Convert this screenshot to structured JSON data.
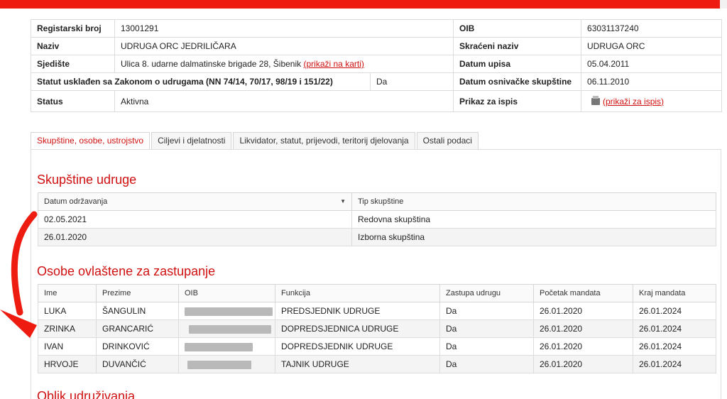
{
  "info": {
    "registarski_broj": {
      "label": "Registarski broj",
      "value": "13001291"
    },
    "oib": {
      "label": "OIB",
      "value": "63031137240"
    },
    "naziv": {
      "label": "Naziv",
      "value": "UDRUGA ORC JEDRILIČARA"
    },
    "skraceni_naziv": {
      "label": "Skraćeni naziv",
      "value": "UDRUGA ORC"
    },
    "sjediste": {
      "label": "Sjedište",
      "value": "Ulica 8. udarne dalmatinske brigade 28, Šibenik",
      "link": "(prikaži na karti)"
    },
    "datum_upisa": {
      "label": "Datum upisa",
      "value": "05.04.2011"
    },
    "statut": {
      "label": "Statut usklađen sa Zakonom o udrugama (NN 74/14, 70/17, 98/19 i 151/22)",
      "value": "Da"
    },
    "datum_osnivacke": {
      "label": "Datum osnivačke skupštine",
      "value": "06.11.2010"
    },
    "status": {
      "label": "Status",
      "value": "Aktivna"
    },
    "prikaz": {
      "label": "Prikaz za ispis",
      "link": "(prikaži za ispis)"
    }
  },
  "tabs": [
    {
      "label": "Skupštine, osobe, ustrojstvo"
    },
    {
      "label": "Ciljevi i djelatnosti"
    },
    {
      "label": "Likvidator, statut, prijevodi, teritorij djelovanja"
    },
    {
      "label": "Ostali podaci"
    }
  ],
  "skupstine": {
    "title": "Skupštine udruge",
    "headers": [
      "Datum održavanja",
      "Tip skupštine"
    ],
    "rows": [
      [
        "02.05.2021",
        "Redovna skupština"
      ],
      [
        "26.01.2020",
        "Izborna skupština"
      ]
    ]
  },
  "osobe": {
    "title": "Osobe ovlaštene za zastupanje",
    "headers": [
      "Ime",
      "Prezime",
      "OIB",
      "Funkcija",
      "Zastupa udrugu",
      "Početak mandata",
      "Kraj mandata"
    ],
    "rows": [
      [
        "LUKA",
        "ŠANGULIN",
        "",
        "PREDSJEDNIK UDRUGE",
        "Da",
        "26.01.2020",
        "26.01.2024"
      ],
      [
        "ZRINKA",
        "GRANCARIĆ",
        "",
        "DOPREDSJEDNICA UDRUGE",
        "Da",
        "26.01.2020",
        "26.01.2024"
      ],
      [
        "IVAN",
        "DRINKOVIĆ",
        "",
        "DOPREDSJEDNIK UDRUGE",
        "Da",
        "26.01.2020",
        "26.01.2024"
      ],
      [
        "HRVOJE",
        "DUVANČIĆ",
        "",
        "TAJNIK UDRUGE",
        "Da",
        "26.01.2020",
        "26.01.2024"
      ]
    ]
  },
  "next_section": {
    "title": "Oblik udruživanja"
  },
  "colors": {
    "accent": "#d01010",
    "topbar": "#ee1c10"
  }
}
